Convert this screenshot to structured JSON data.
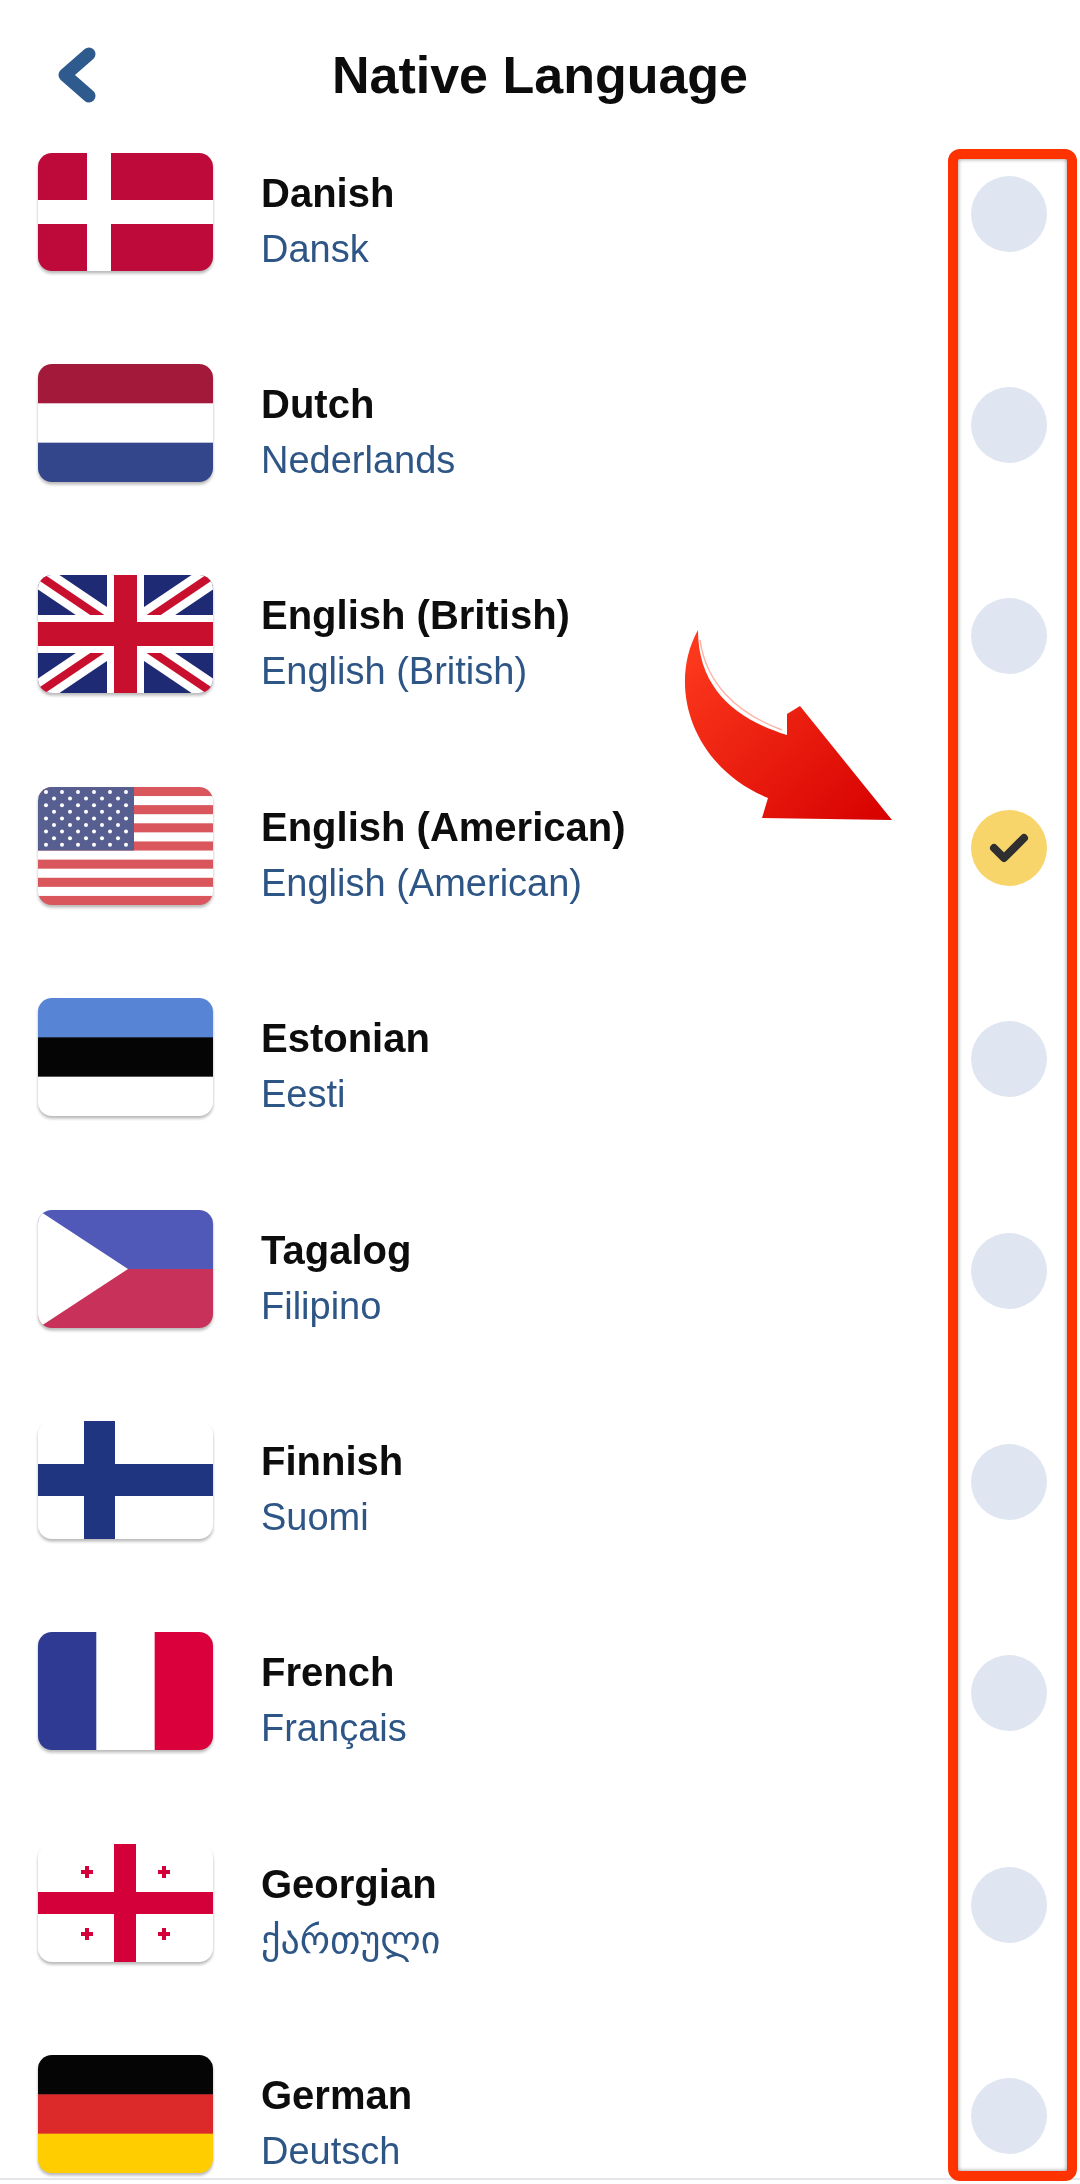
{
  "header": {
    "title": "Native Language"
  },
  "languages": [
    {
      "name": "Danish",
      "native": "Dansk",
      "selected": false
    },
    {
      "name": "Dutch",
      "native": "Nederlands",
      "selected": false
    },
    {
      "name": "English (British)",
      "native": "English (British)",
      "selected": false
    },
    {
      "name": "English (American)",
      "native": "English (American)",
      "selected": true
    },
    {
      "name": "Estonian",
      "native": "Eesti",
      "selected": false
    },
    {
      "name": "Tagalog",
      "native": "Filipino",
      "selected": false
    },
    {
      "name": "Finnish",
      "native": "Suomi",
      "selected": false
    },
    {
      "name": "French",
      "native": "Français",
      "selected": false
    },
    {
      "name": "Georgian",
      "native": "ქართული",
      "selected": false
    },
    {
      "name": "German",
      "native": "Deutsch",
      "selected": false
    }
  ]
}
